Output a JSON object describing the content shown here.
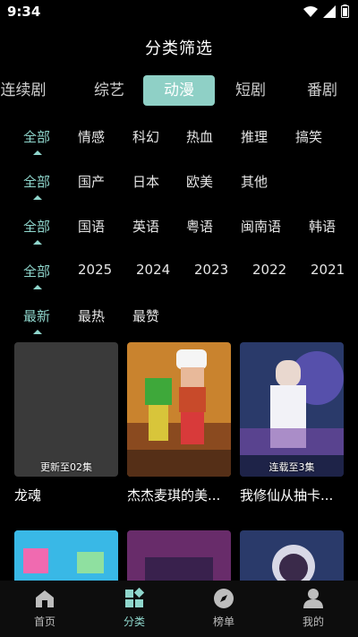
{
  "status": {
    "time": "9:34"
  },
  "page_title": "分类筛选",
  "category_tabs": [
    {
      "label": "连续剧",
      "active": false
    },
    {
      "label": "综艺",
      "active": false
    },
    {
      "label": "动漫",
      "active": true
    },
    {
      "label": "短剧",
      "active": false
    },
    {
      "label": "番剧",
      "active": false
    }
  ],
  "filters": {
    "genre": [
      "全部",
      "情感",
      "科幻",
      "热血",
      "推理",
      "搞笑"
    ],
    "region": [
      "全部",
      "国产",
      "日本",
      "欧美",
      "其他"
    ],
    "language": [
      "全部",
      "国语",
      "英语",
      "粤语",
      "闽南语",
      "韩语"
    ],
    "year": [
      "全部",
      "2025",
      "2024",
      "2023",
      "2022",
      "2021"
    ],
    "sort": [
      "最新",
      "最热",
      "最赞"
    ]
  },
  "cards": [
    {
      "title": "龙魂",
      "caption": "更新至02集"
    },
    {
      "title": "杰杰麦琪的美...",
      "caption": ""
    },
    {
      "title": "我修仙从抽卡...",
      "caption": "连载至3集"
    }
  ],
  "bottom_nav": [
    {
      "label": "首页",
      "active": false
    },
    {
      "label": "分类",
      "active": true
    },
    {
      "label": "榜单",
      "active": false
    },
    {
      "label": "我的",
      "active": false
    }
  ],
  "colors": {
    "accent": "#8fd6cc",
    "active_tab_bg": "#8fd0c6",
    "background": "#000000"
  }
}
